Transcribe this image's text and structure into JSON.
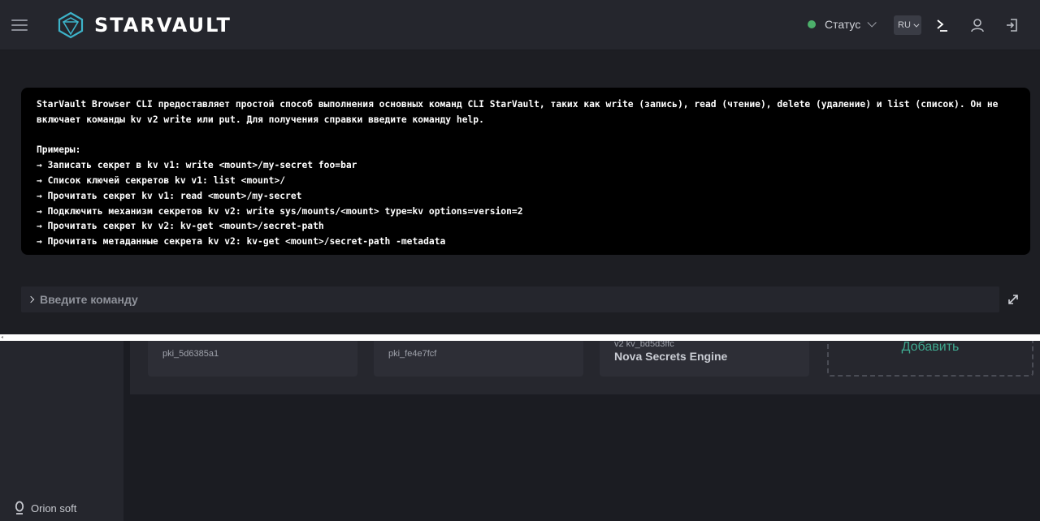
{
  "app": {
    "brand": "STARVAULT",
    "status_label": "Статус",
    "status_color": "#4caf6a",
    "language": "RU",
    "accent": "#3fa88f"
  },
  "header_icons": [
    "menu-icon",
    "logo-icon",
    "terminal-icon",
    "user-icon",
    "logout-icon"
  ],
  "cli": {
    "output_lines": [
      "StarVault Browser CLI предоставляет простой способ выполнения основных команд CLI StarVault, таких как write (запись), read (чтение), delete (удаление) и list (список). Он не",
      "включает команды kv v2 write или put. Для получения справки введите команду help.",
      "",
      "Примеры:",
      "→ Записать секрет в kv v1: write <mount>/my-secret foo=bar",
      "→ Список ключей секретов kv v1: list <mount>/",
      "→ Прочитать секрет kv v1: read <mount>/my-secret",
      "→ Подключить механизм секретов kv v2: write sys/mounts/<mount> type=kv options=version=2",
      "→ Прочитать секрет kv v2: kv-get <mount>/secret-path",
      "→ Прочитать метаданные секрета kv v2: kv-get <mount>/secret-path -metadata"
    ],
    "input_placeholder": "Введите команду",
    "input_value": ""
  },
  "engines": [
    {
      "id": "pki_5d6385a1",
      "title": ""
    },
    {
      "id": "pki_fe4e7fcf",
      "title": ""
    },
    {
      "id": "v2 kv_bd5d3ffc",
      "title": "Nova Secrets Engine"
    }
  ],
  "add_label": "Добавить",
  "footer": {
    "org_name": "Orion soft"
  }
}
